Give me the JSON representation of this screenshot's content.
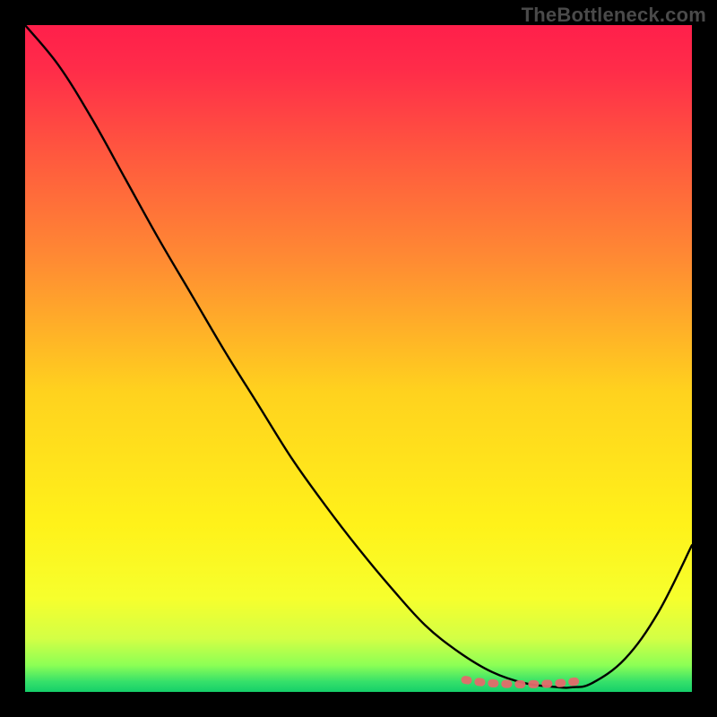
{
  "watermark": "TheBottleneck.com",
  "chart_data": {
    "type": "line",
    "title": "",
    "xlabel": "",
    "ylabel": "",
    "xlim": [
      0,
      100
    ],
    "ylim": [
      0,
      100
    ],
    "grid": false,
    "series": [
      {
        "name": "curve",
        "x": [
          0,
          5,
          10,
          15,
          20,
          25,
          30,
          35,
          40,
          45,
          50,
          55,
          60,
          65,
          70,
          75,
          80,
          82,
          85,
          90,
          95,
          100
        ],
        "y": [
          100,
          94,
          86,
          77,
          68,
          59.5,
          51,
          43,
          35,
          28,
          21.5,
          15.5,
          10,
          6,
          3,
          1.3,
          0.7,
          0.7,
          1.3,
          5,
          12,
          22
        ]
      },
      {
        "name": "flat-band",
        "x": [
          66,
          68,
          70,
          72,
          74,
          76,
          78,
          80,
          82,
          84
        ],
        "y": [
          1.8,
          1.5,
          1.3,
          1.2,
          1.15,
          1.15,
          1.2,
          1.3,
          1.5,
          1.8
        ]
      }
    ],
    "gradient_stops": [
      {
        "offset": 0.0,
        "color": "#ff1f4b"
      },
      {
        "offset": 0.07,
        "color": "#ff2d49"
      },
      {
        "offset": 0.2,
        "color": "#ff5a3e"
      },
      {
        "offset": 0.35,
        "color": "#ff8a33"
      },
      {
        "offset": 0.55,
        "color": "#ffd21e"
      },
      {
        "offset": 0.75,
        "color": "#fff21a"
      },
      {
        "offset": 0.86,
        "color": "#f6ff2d"
      },
      {
        "offset": 0.92,
        "color": "#d3ff45"
      },
      {
        "offset": 0.96,
        "color": "#8cff55"
      },
      {
        "offset": 0.985,
        "color": "#35e06a"
      },
      {
        "offset": 1.0,
        "color": "#15cf69"
      }
    ],
    "flat_band_color": "#e46a6c"
  }
}
